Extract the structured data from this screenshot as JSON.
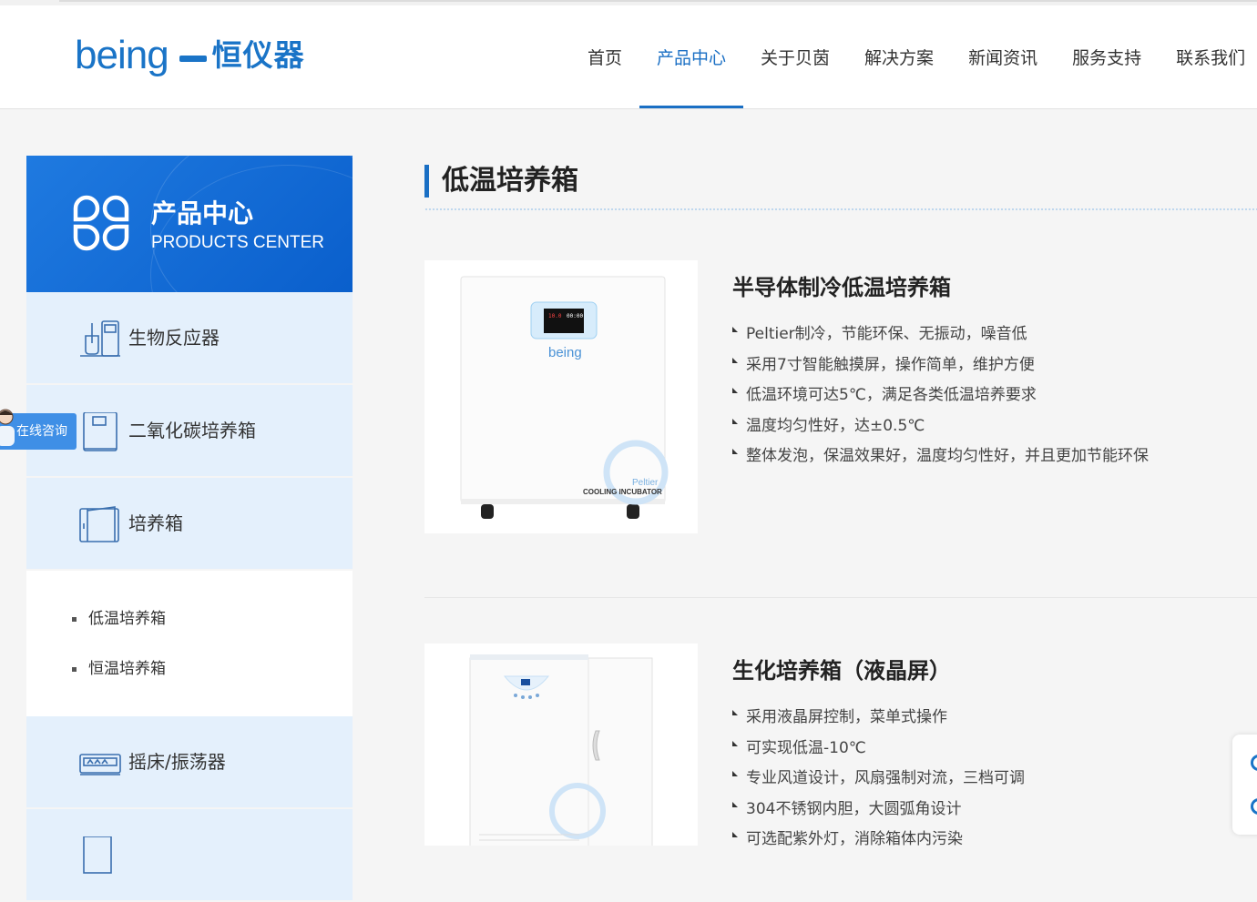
{
  "logo": {
    "en": "being",
    "cn": "恒仪器"
  },
  "nav": [
    {
      "label": "首页"
    },
    {
      "label": "产品中心",
      "active": true
    },
    {
      "label": "关于贝茵"
    },
    {
      "label": "解决方案"
    },
    {
      "label": "新闻资讯"
    },
    {
      "label": "服务支持"
    },
    {
      "label": "联系我们"
    }
  ],
  "sidebar": {
    "title": "产品中心",
    "subtitle": "PRODUCTS CENTER",
    "categories": [
      {
        "label": "生物反应器",
        "icon": "bioreactor-icon"
      },
      {
        "label": "二氧化碳培养箱",
        "icon": "co2-incubator-icon"
      },
      {
        "label": "培养箱",
        "icon": "incubator-icon"
      }
    ],
    "subitems": [
      "低温培养箱",
      "恒温培养箱"
    ],
    "categories_after": [
      {
        "label": "摇床/振荡器",
        "icon": "shaker-icon"
      }
    ]
  },
  "consult": {
    "label": "在线咨询"
  },
  "main": {
    "title": "低温培养箱",
    "products": [
      {
        "name": "半导体制冷低温培养箱",
        "image_text": {
          "brand": "being",
          "tag1": "Peltier",
          "tag2": "COOLING INCUBATOR",
          "display1": "10.0",
          "display2": "00:00"
        },
        "features": [
          "Peltier制冷，节能环保、无振动，噪音低",
          "采用7寸智能触摸屏，操作简单，维护方便",
          "低温环境可达5℃，满足各类低温培养要求",
          "温度均匀性好，达±0.5℃",
          "整体发泡，保温效果好，温度均匀性好，并且更加节能环保"
        ]
      },
      {
        "name": "生化培养箱（液晶屏）",
        "features": [
          "采用液晶屏控制，菜单式操作",
          "可实现低温-10℃",
          "专业风道设计，风扇强制对流，三档可调",
          "304不锈钢内胆，大圆弧角设计",
          "可选配紫外灯，消除箱体内污染"
        ]
      }
    ]
  },
  "colors": {
    "brand": "#1a74c7",
    "active": "#1a6fc4",
    "sidebar_bg": "#e4f0fc",
    "header_bg": "#ffffff",
    "page_bg": "#f5f5f5"
  }
}
